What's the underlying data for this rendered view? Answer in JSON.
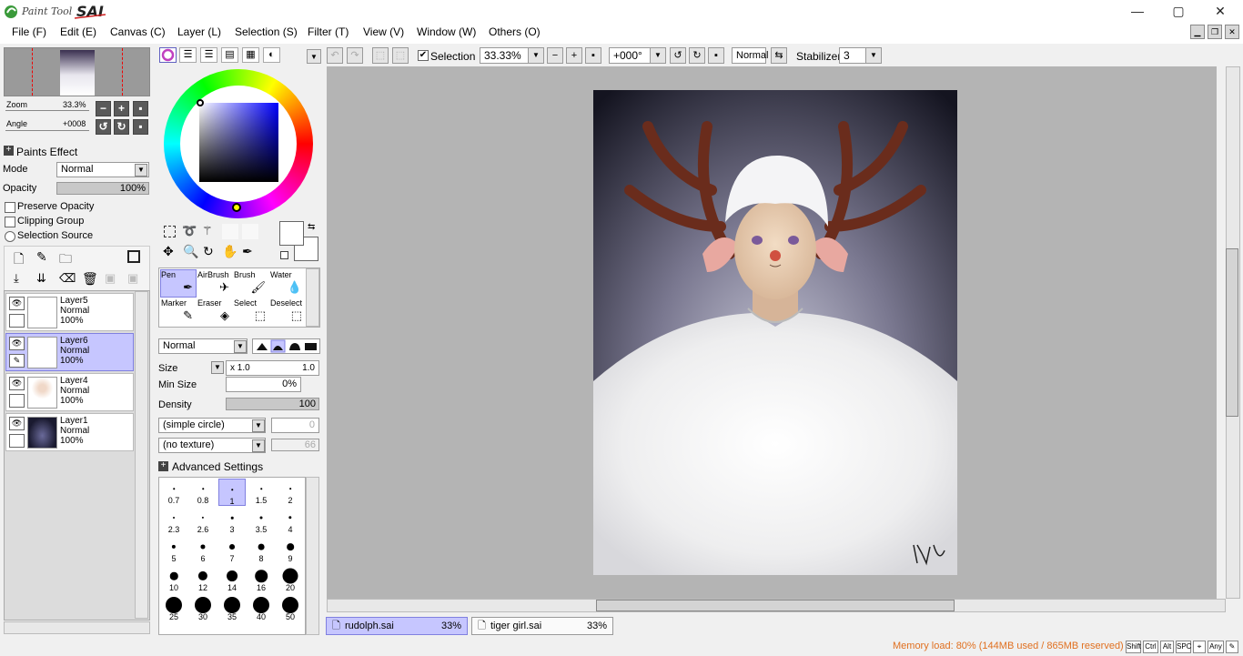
{
  "app": {
    "title": "Paint Tool SAI"
  },
  "window_buttons": {
    "minimize": "—",
    "maximize": "▢",
    "close": "✕"
  },
  "menu": [
    "File (F)",
    "Edit (E)",
    "Canvas (C)",
    "Layer (L)",
    "Selection (S)",
    "Filter (T)",
    "View (V)",
    "Window (W)",
    "Others (O)"
  ],
  "navigator": {
    "zoom_label": "Zoom",
    "zoom_value": "33.3%",
    "angle_label": "Angle",
    "angle_value": "+0008"
  },
  "layer_panel": {
    "paints_effect": "Paints Effect",
    "mode_label": "Mode",
    "mode_value": "Normal",
    "opacity_label": "Opacity",
    "opacity_value": "100%",
    "preserve_opacity": "Preserve Opacity",
    "clipping_group": "Clipping Group",
    "selection_source": "Selection Source",
    "layers": [
      {
        "name": "Layer5",
        "mode": "Normal",
        "opacity": "100%"
      },
      {
        "name": "Layer6",
        "mode": "Normal",
        "opacity": "100%"
      },
      {
        "name": "Layer4",
        "mode": "Normal",
        "opacity": "100%"
      },
      {
        "name": "Layer1",
        "mode": "Normal",
        "opacity": "100%"
      }
    ]
  },
  "color": {
    "primary": "#0000c8",
    "foreground": "#ffffff",
    "background": "#ffffff"
  },
  "tools": {
    "row1": [
      "Pen",
      "AirBrush",
      "Brush",
      "Water"
    ],
    "row2": [
      "Marker",
      "Eraser",
      "Select",
      "Deselect"
    ],
    "blend_mode": "Normal",
    "size_label": "Size",
    "size_mult": "x 1.0",
    "size_value": "1.0",
    "min_size_label": "Min Size",
    "min_size_value": "0%",
    "density_label": "Density",
    "density_value": "100",
    "shape": "(simple circle)",
    "shape_value": "0",
    "texture": "(no texture)",
    "texture_value": "66",
    "advanced": "Advanced Settings",
    "brush_sizes": [
      "0.7",
      "0.8",
      "1",
      "1.5",
      "2",
      "2.3",
      "2.6",
      "3",
      "3.5",
      "4",
      "5",
      "6",
      "7",
      "8",
      "9",
      "10",
      "12",
      "14",
      "16",
      "20",
      "25",
      "30",
      "35",
      "40",
      "50"
    ]
  },
  "toolbar": {
    "selection_label": "Selection",
    "zoom": "33.33%",
    "rotation": "+000°",
    "blend": "Normal",
    "stabilizer_label": "Stabilizer",
    "stabilizer_value": "3"
  },
  "tabs": [
    {
      "name": "rudolph.sai",
      "zoom": "33%"
    },
    {
      "name": "tiger girl.sai",
      "zoom": "33%"
    }
  ],
  "status": {
    "memory": "Memory load: 80% (144MB used / 865MB reserved)",
    "keys": [
      "Shift",
      "Ctrl",
      "Alt",
      "SPC",
      "⌖",
      "Any",
      "✎"
    ]
  }
}
